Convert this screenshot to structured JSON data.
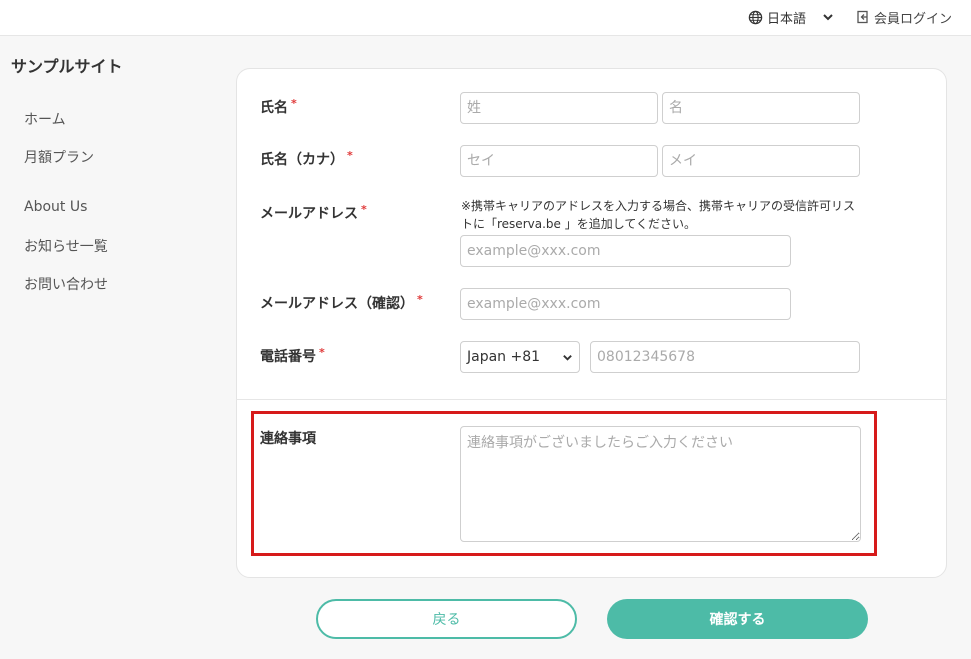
{
  "header": {
    "language_label": "日本語",
    "login_label": "会員ログイン"
  },
  "sidebar": {
    "site_title": "サンプルサイト",
    "items": [
      {
        "label": "ホーム"
      },
      {
        "label": "月額プラン"
      },
      {
        "label": "About Us"
      },
      {
        "label": "お知らせ一覧"
      },
      {
        "label": "お問い合わせ"
      }
    ]
  },
  "form": {
    "required_mark": "*",
    "name": {
      "label": "氏名",
      "last_placeholder": "姓",
      "first_placeholder": "名"
    },
    "name_kana": {
      "label": "氏名（カナ）",
      "last_placeholder": "セイ",
      "first_placeholder": "メイ"
    },
    "email": {
      "label": "メールアドレス",
      "note": "※携帯キャリアのアドレスを入力する場合、携帯キャリアの受信許可リストに「reserva.be 」を追加してください。",
      "placeholder": "example@xxx.com"
    },
    "email_confirm": {
      "label": "メールアドレス（確認）",
      "placeholder": "example@xxx.com"
    },
    "phone": {
      "label": "電話番号",
      "country_value": "Japan +81",
      "placeholder": "08012345678"
    },
    "message": {
      "label": "連絡事項",
      "placeholder": "連絡事項がございましたらご入力ください"
    }
  },
  "buttons": {
    "back_label": "戻る",
    "confirm_label": "確認する"
  },
  "colors": {
    "accent": "#4dbba7",
    "required": "#e03a3a",
    "highlight": "#d61a1a"
  }
}
